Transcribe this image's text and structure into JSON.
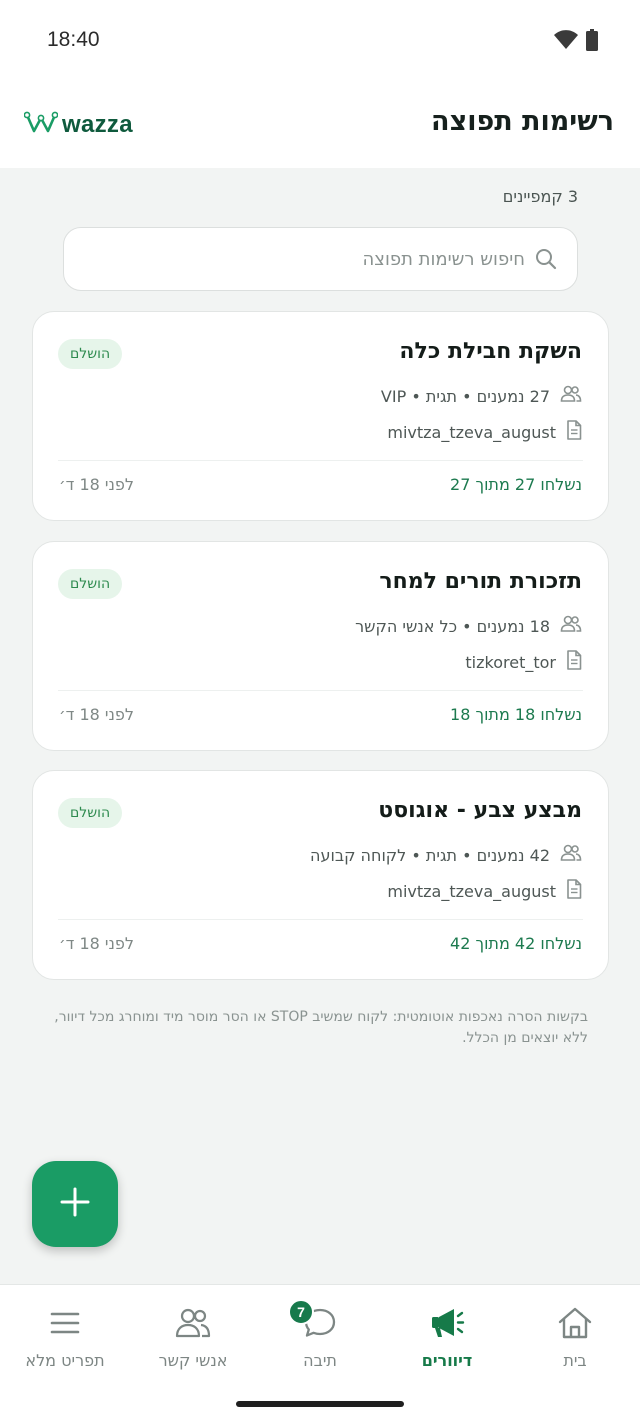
{
  "status_bar": {
    "time": "18:40",
    "icons": [
      "wifi-icon",
      "battery-icon"
    ]
  },
  "header": {
    "title": "רשימות תפוצה",
    "logo_text": "wazza",
    "logo_icon": "wazza-w-logo"
  },
  "campaign_count": "3 קמפיינים",
  "search": {
    "placeholder": "חיפוש רשימות תפוצה",
    "value": ""
  },
  "campaigns": [
    {
      "name": "השקת חבילת כלה",
      "status": "הושלם",
      "audience": "27 נמענים • תגית • VIP",
      "template": "mivtza_tzeva_august",
      "sent": "נשלחו 27 מתוך 27",
      "ago": "לפני 18 ד׳"
    },
    {
      "name": "תזכורת תורים למחר",
      "status": "הושלם",
      "audience": "18 נמענים • כל אנשי הקשר",
      "template": "tizkoret_tor",
      "sent": "נשלחו 18 מתוך 18",
      "ago": "לפני 18 ד׳"
    },
    {
      "name": "מבצע צבע - אוגוסט",
      "status": "הושלם",
      "audience": "42 נמענים • תגית • לקוחה קבועה",
      "template": "mivtza_tzeva_august",
      "sent": "נשלחו 42 מתוך 42",
      "ago": "לפני 18 ד׳"
    }
  ],
  "footer_note": "בקשות הסרה נאכפות אוטומטית: לקוח שמשיב STOP או הסר מוסר מיד ומוחרג מכל דיוור, ללא יוצאים מן הכלל.",
  "fab": {
    "icon": "plus-icon"
  },
  "bottom_nav": {
    "items": [
      {
        "label": "בית",
        "icon": "home-icon",
        "active": false
      },
      {
        "label": "דיוורים",
        "icon": "megaphone-icon",
        "active": true
      },
      {
        "label": "תיבה",
        "icon": "chat-icon",
        "active": false,
        "badge": "7"
      },
      {
        "label": "אנשי קשר",
        "icon": "contacts-icon",
        "active": false
      },
      {
        "label": "תפריט מלא",
        "icon": "menu-icon",
        "active": false
      }
    ]
  },
  "colors": {
    "accent": "#1a9c65",
    "accent_dark": "#167a49",
    "badge_bg": "#e6f5ea",
    "badge_text": "#2e8b4f",
    "background": "#f2f4f3"
  }
}
